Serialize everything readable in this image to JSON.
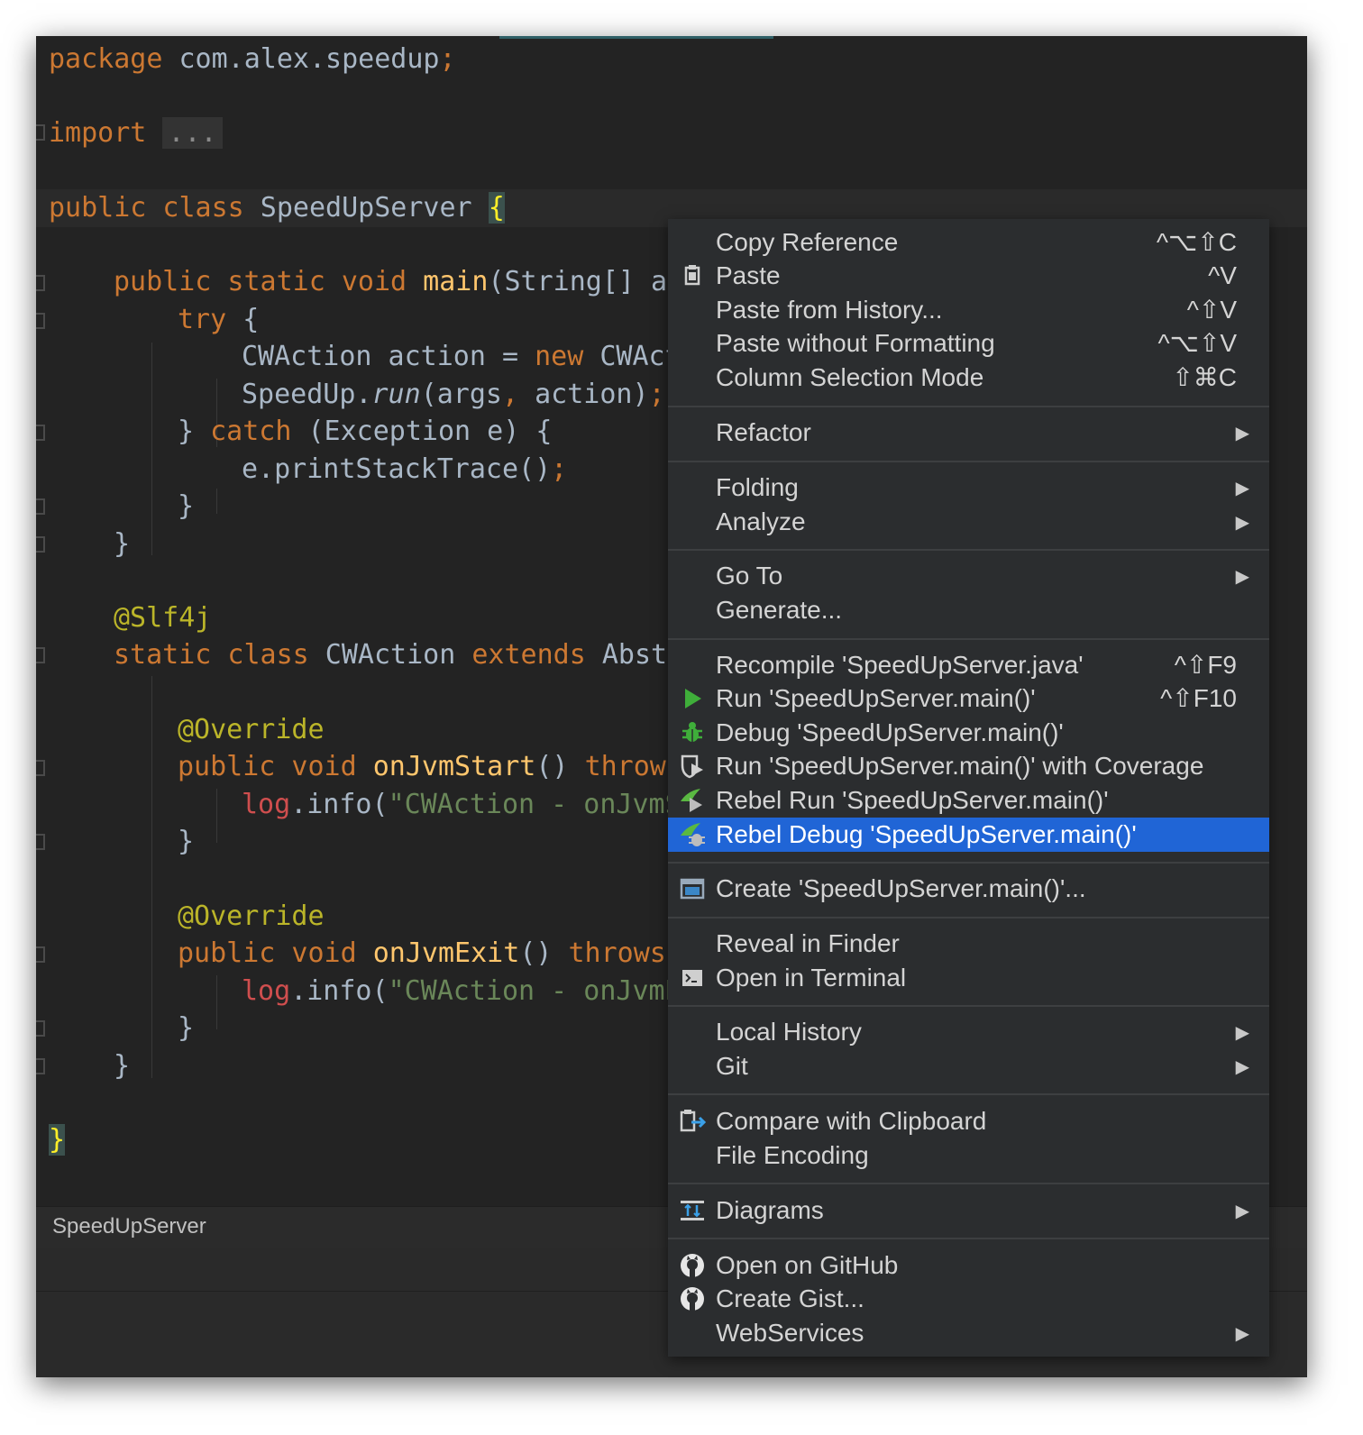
{
  "editor": {
    "l_package_kw": "package",
    "l_package_name": " com.alex.speedup",
    "l_package_semi": ";",
    "l_import_kw": "import",
    "l_import_fold": "...",
    "l_class_kw": "public class",
    "l_class_name": " SpeedUpServer ",
    "l_class_brace": "{",
    "l_main_kw": "public static void",
    "l_main_fn": "main",
    "l_main_rest": "(String[] ar",
    "l_try_kw": "try",
    "l_try_rest": " {",
    "l_cw_a": "CWAction action = ",
    "l_cw_kw": "new",
    "l_cw_b": " CWAct",
    "l_run_a": "SpeedUp.",
    "l_run_fn": "run",
    "l_run_b": "(args",
    "l_run_comma": ",",
    "l_run_c": " action)",
    "l_run_semi": ";",
    "l_catch_a": "} ",
    "l_catch_kw": "catch",
    "l_catch_b": " (Exception e) {",
    "l_pst": "e.printStackTrace()",
    "l_pst_semi": ";",
    "l_close1": "}",
    "l_close2": "}",
    "l_slf4j": "@Slf4j",
    "l_static_kw": "static class",
    "l_static_name": " CWAction ",
    "l_extends_kw": "extends",
    "l_extends_rest": " Abstr",
    "l_override1": "@Override",
    "l_start_kw": "public void",
    "l_start_fn": " onJvmStart",
    "l_start_paren": "() ",
    "l_start_throws": "throws",
    "l_log1_fld": "log",
    "l_log1_a": ".info(",
    "l_log1_str": "\"CWAction - onJvmS",
    "l_close3": "}",
    "l_override2": "@Override",
    "l_exit_kw": "public void",
    "l_exit_fn": " onJvmExit",
    "l_exit_paren": "() ",
    "l_exit_throws": "throws",
    "l_log2_fld": "log",
    "l_log2_a": ".info(",
    "l_log2_str": "\"CWAction - onJvmE",
    "l_close4": "}",
    "l_close5": "}",
    "l_close6": "}"
  },
  "status": {
    "breadcrumb": "SpeedUpServer"
  },
  "context_menu": {
    "items": [
      {
        "label": "Copy Reference",
        "shortcut": "^⌥⇧C"
      },
      {
        "label": "Paste",
        "shortcut": "^V",
        "icon": "clipboard-icon"
      },
      {
        "label": "Paste from History...",
        "shortcut": "^⇧V"
      },
      {
        "label": "Paste without Formatting",
        "shortcut": "^⌥⇧V"
      },
      {
        "label": "Column Selection Mode",
        "shortcut": "⇧⌘C"
      },
      {
        "label": "Refactor",
        "submenu": true
      },
      {
        "label": "Folding",
        "submenu": true
      },
      {
        "label": "Analyze",
        "submenu": true
      },
      {
        "label": "Go To",
        "submenu": true
      },
      {
        "label": "Generate..."
      },
      {
        "label": "Recompile 'SpeedUpServer.java'",
        "shortcut": "^⇧F9"
      },
      {
        "label": "Run 'SpeedUpServer.main()'",
        "shortcut": "^⇧F10",
        "icon": "run-icon"
      },
      {
        "label": "Debug 'SpeedUpServer.main()'",
        "icon": "bug-icon"
      },
      {
        "label": "Run 'SpeedUpServer.main()' with Coverage",
        "icon": "coverage-icon"
      },
      {
        "label": "Rebel Run 'SpeedUpServer.main()'",
        "icon": "jrebel-run-icon"
      },
      {
        "label": "Rebel Debug 'SpeedUpServer.main()'",
        "icon": "jrebel-debug-icon",
        "selected": true
      },
      {
        "label": "Create 'SpeedUpServer.main()'...",
        "icon": "run-config-icon"
      },
      {
        "label": "Reveal in Finder"
      },
      {
        "label": "Open in Terminal",
        "icon": "terminal-icon"
      },
      {
        "label": "Local History",
        "submenu": true
      },
      {
        "label": "Git",
        "submenu": true
      },
      {
        "label": "Compare with Clipboard",
        "icon": "compare-icon"
      },
      {
        "label": "File Encoding"
      },
      {
        "label": "Diagrams",
        "submenu": true,
        "icon": "diagram-icon"
      },
      {
        "label": "Open on GitHub",
        "icon": "github-icon"
      },
      {
        "label": "Create Gist...",
        "icon": "github-icon"
      },
      {
        "label": "WebServices",
        "submenu": true
      }
    ],
    "submenu_arrow": "▶",
    "colors": {
      "background": "#2b2d2f",
      "selected": "#2065d6",
      "text": "#d4d4d4"
    }
  },
  "colors": {
    "editor_bg": "#232323",
    "keyword": "#cc7832",
    "function": "#ffc66d",
    "annotation": "#bbb529",
    "string": "#6a8759",
    "field": "#cf4e4e",
    "plain": "#a9b7c6"
  }
}
